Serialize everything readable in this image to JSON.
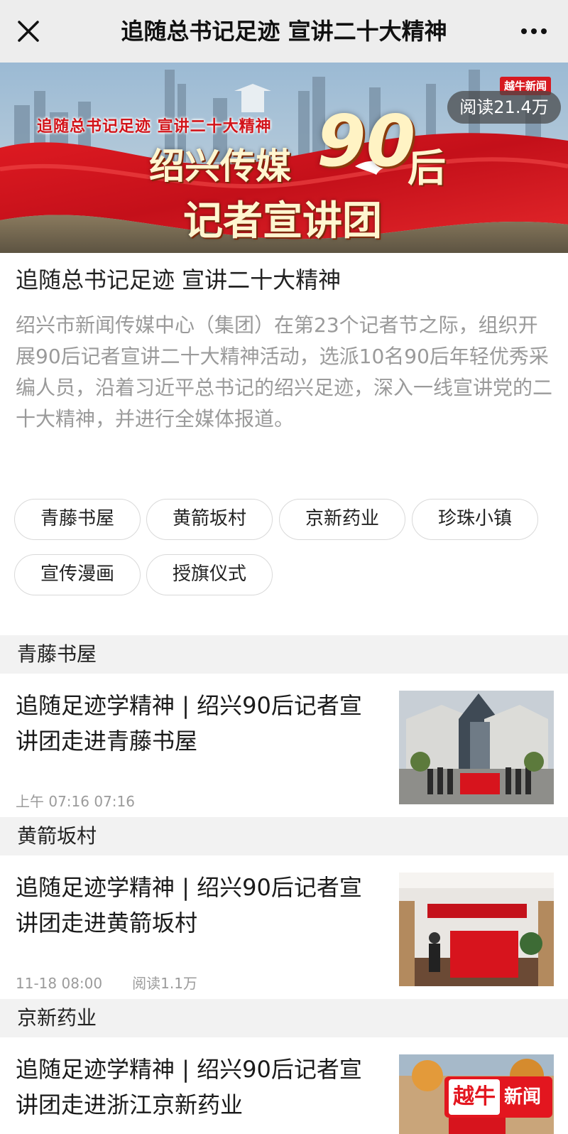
{
  "nav": {
    "title": "追随总书记足迹 宣讲二十大精神",
    "close_icon": "close-icon",
    "more_icon": "more-icon"
  },
  "banner": {
    "subtitle": "追随总书记足迹 宣讲二十大精神",
    "main_line1": "绍兴传媒",
    "main_90": "90",
    "main_hou": "后",
    "main_line2": "记者宣讲团",
    "logo": "越牛新闻",
    "read_count": "阅读21.4万",
    "colors": {
      "red": "#d7141d",
      "sky": "#8fb0cc"
    }
  },
  "intro": {
    "title": "追随总书记足迹 宣讲二十大精神",
    "description": "绍兴市新闻传媒中心（集团）在第23个记者节之际，组织开展90后记者宣讲二十大精神活动，选派10名90后年轻优秀采编人员，沿着习近平总书记的绍兴足迹，深入一线宣讲党的二十大精神，并进行全媒体报道。"
  },
  "tags": [
    "青藤书屋",
    "黄箭坂村",
    "京新药业",
    "珍珠小镇",
    "宣传漫画",
    "授旗仪式"
  ],
  "sections": [
    {
      "header": "青藤书屋",
      "article": {
        "title": "追随足迹学精神 | 绍兴90后记者宣讲团走进青藤书屋",
        "time": "上午 07:16 07:16",
        "reads": ""
      }
    },
    {
      "header": "黄箭坂村",
      "article": {
        "title": "追随足迹学精神 | 绍兴90后记者宣讲团走进黄箭坂村",
        "time": "11-18 08:00",
        "reads": "阅读1.1万"
      }
    },
    {
      "header": "京新药业",
      "article": {
        "title": "追随足迹学精神 | 绍兴90后记者宣讲团走进浙江京新药业",
        "time": "",
        "reads": ""
      }
    }
  ],
  "watermark": {
    "left": "越牛",
    "right": "新闻"
  }
}
